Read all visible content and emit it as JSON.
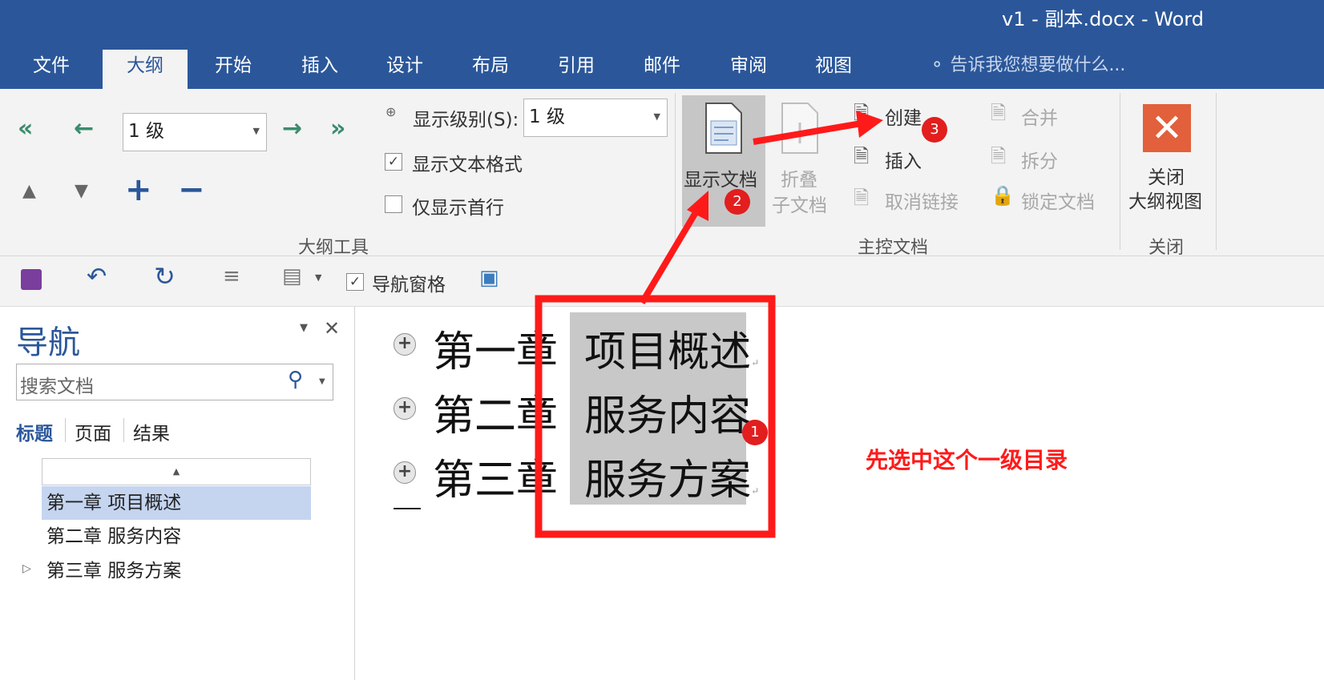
{
  "window": {
    "title": "v1 - 副本.docx - Word"
  },
  "tabs": [
    "文件",
    "大纲",
    "开始",
    "插入",
    "设计",
    "布局",
    "引用",
    "邮件",
    "审阅",
    "视图"
  ],
  "active_tab": "大纲",
  "tell_me": "告诉我您想要做什么...",
  "ribbon": {
    "outline_tools": {
      "level_combo": "1 级",
      "show_level_label": "显示级别(S):",
      "show_level_value": "1 级",
      "show_text_format": "显示文本格式",
      "show_text_format_checked": true,
      "show_first_line": "仅显示首行",
      "show_first_line_checked": false,
      "group_label": "大纲工具"
    },
    "master_document": {
      "show_document": "显示文档",
      "collapse_line1": "折叠",
      "collapse_line2": "子文档",
      "create": "创建",
      "insert": "插入",
      "unlink": "取消链接",
      "merge": "合并",
      "split": "拆分",
      "lock": "锁定文档",
      "group_label": "主控文档"
    },
    "close": {
      "line1": "关闭",
      "line2": "大纲视图",
      "group_label": "关闭"
    }
  },
  "qat": {
    "nav_pane_label": "导航窗格",
    "nav_pane_checked": true
  },
  "nav_pane": {
    "title": "导航",
    "search_placeholder": "搜索文档",
    "tabs": [
      "标题",
      "页面",
      "结果"
    ],
    "items": [
      "第一章 项目概述",
      "第二章 服务内容",
      "第三章 服务方案"
    ]
  },
  "document": {
    "lines": [
      {
        "chapter": "第一章",
        "title": "项目概述"
      },
      {
        "chapter": "第二章",
        "title": "服务内容"
      },
      {
        "chapter": "第三章",
        "title": "服务方案"
      }
    ]
  },
  "annotations": {
    "note": "先选中这个一级目录",
    "badges": [
      "1",
      "2",
      "3"
    ],
    "colors": {
      "highlight": "#ff1a1a",
      "badge": "#e21e1e",
      "word_blue": "#2b579a"
    }
  }
}
